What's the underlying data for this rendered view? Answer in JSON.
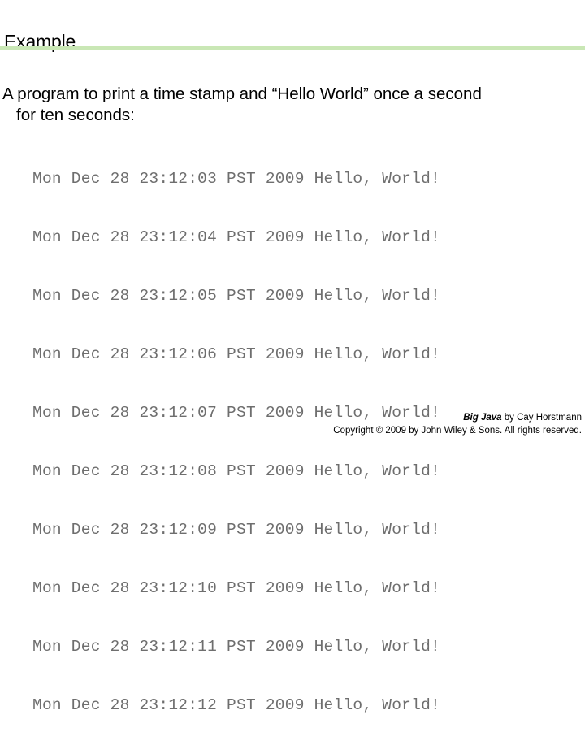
{
  "slide": {
    "title": "Example",
    "accent_color": "#c9e7b5",
    "body": {
      "line1": "A program to print a time stamp and “Hello World” once a second",
      "line2": "for ten seconds:"
    },
    "console_output": {
      "text_color": "#6e6e6e",
      "lines": [
        "Mon Dec 28 23:12:03 PST 2009 Hello, World!",
        "Mon Dec 28 23:12:04 PST 2009 Hello, World!",
        "Mon Dec 28 23:12:05 PST 2009 Hello, World!",
        "Mon Dec 28 23:12:06 PST 2009 Hello, World!",
        "Mon Dec 28 23:12:07 PST 2009 Hello, World!",
        "Mon Dec 28 23:12:08 PST 2009 Hello, World!",
        "Mon Dec 28 23:12:09 PST 2009 Hello, World!",
        "Mon Dec 28 23:12:10 PST 2009 Hello, World!",
        "Mon Dec 28 23:12:11 PST 2009 Hello, World!",
        "Mon Dec 28 23:12:12 PST 2009 Hello, World!"
      ]
    },
    "footer": {
      "book_title": "Big Java",
      "attribution": " by Cay Horstmann",
      "copyright": "Copyright © 2009 by John Wiley & Sons.  All rights reserved."
    }
  }
}
